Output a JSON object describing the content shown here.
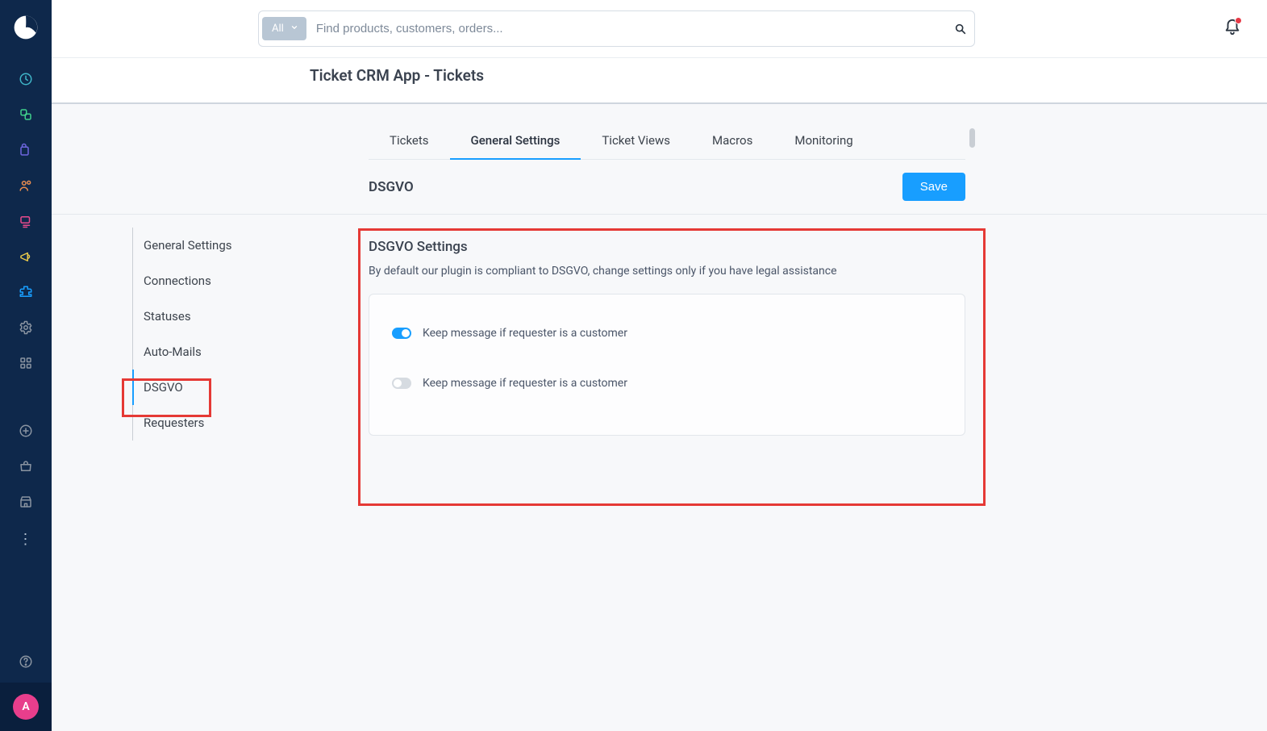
{
  "search": {
    "pill_label": "All",
    "placeholder": "Find products, customers, orders..."
  },
  "page_title": "Ticket CRM App - Tickets",
  "tabs": [
    "Tickets",
    "General Settings",
    "Ticket Views",
    "Macros",
    "Monitoring"
  ],
  "active_tab_index": 1,
  "section_title": "DSGVO",
  "save_label": "Save",
  "left_menu": [
    "General Settings",
    "Connections",
    "Statuses",
    "Auto-Mails",
    "DSGVO",
    "Requesters"
  ],
  "left_menu_active_index": 4,
  "card": {
    "heading": "DSGVO Settings",
    "sub": "By default our plugin is compliant to DSGVO, change settings only if you have legal assistance",
    "rows": [
      {
        "label": "Keep message if requester is a customer",
        "on": true
      },
      {
        "label": "Keep message if requester is a customer",
        "on": false
      }
    ]
  },
  "avatar_letter": "A"
}
